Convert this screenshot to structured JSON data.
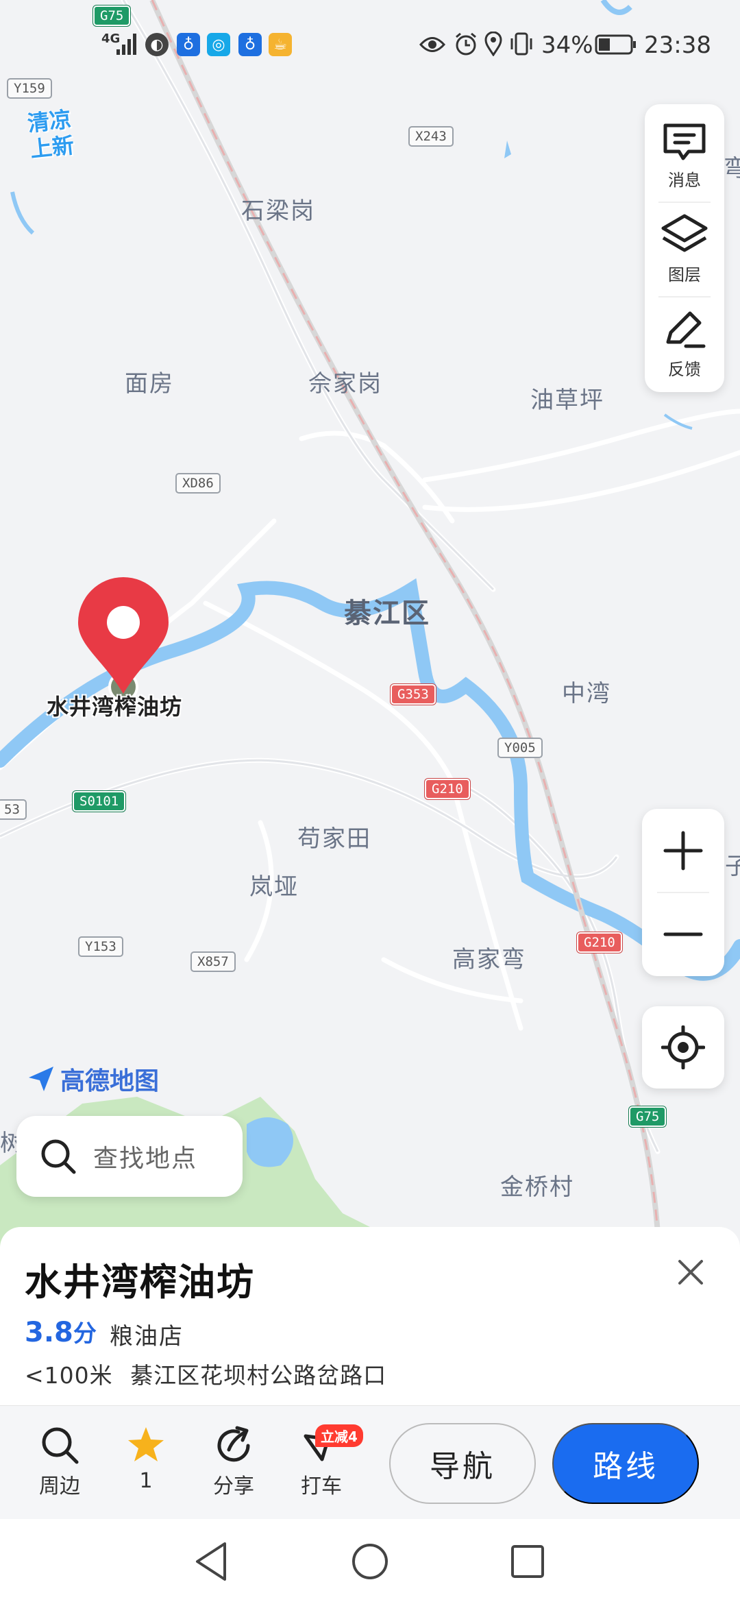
{
  "status_bar": {
    "network": "4G",
    "battery_percent": "34%",
    "time": "23:38",
    "icons": [
      "signal-icon",
      "eye-icon",
      "alarm-icon",
      "location-icon",
      "vibrate-icon",
      "battery-icon"
    ]
  },
  "map": {
    "promo_line1": "清凉",
    "promo_line2": "上新",
    "places": {
      "shilianggang": "石梁岗",
      "mianfang": "面房",
      "shejiagang": "佘家岗",
      "youcaoping": "油草坪",
      "qijiang": "綦江区",
      "zhongwan": "中湾",
      "goujiatian": "苟家田",
      "lanya": "岚垭",
      "gaojiawan": "高家弯",
      "jinqiaocun": "金桥村",
      "edge_wan": "弯",
      "edge_zi": "子",
      "edge_shu": "树"
    },
    "shields": {
      "g75_top": "G75",
      "y159": "Y159",
      "x243": "X243",
      "xd86": "XD86",
      "g353": "G353",
      "y005": "Y005",
      "g210_a": "G210",
      "g210_b": "G210",
      "s0101": "S0101",
      "y53": "53",
      "y153": "Y153",
      "x857": "X857",
      "g75_bottom": "G75"
    },
    "pin_label": "水井湾榨油坊",
    "logo_text": "高德地图"
  },
  "side_panel": {
    "messages": "消息",
    "layers": "图层",
    "feedback": "反馈"
  },
  "search": {
    "placeholder": "查找地点"
  },
  "poi_card": {
    "title": "水井湾榨油坊",
    "rating": "3.8",
    "rating_unit": "分",
    "category": "粮油店",
    "distance": "<100米",
    "address": "綦江区花坝村公路岔路口"
  },
  "actions": {
    "nearby": "周边",
    "favorite_count": "1",
    "share": "分享",
    "taxi": "打车",
    "taxi_promo": "立减4",
    "navigate": "导航",
    "route": "路线"
  },
  "colors": {
    "accent": "#1a6cf0",
    "pin": "#e83a45",
    "water": "#8fc8f5",
    "rating": "#2366e0"
  }
}
